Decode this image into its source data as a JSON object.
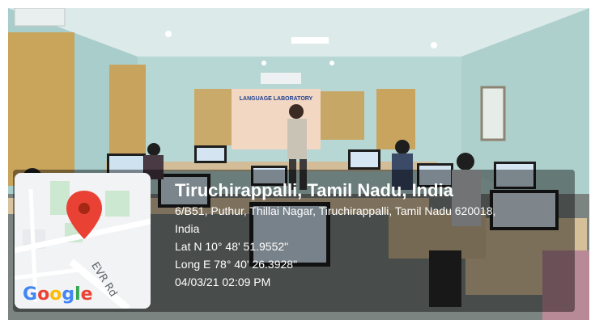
{
  "banner": {
    "title": "LANGUAGE LABORATORY"
  },
  "location": {
    "city": "Tiruchirappalli, Tamil Nadu, India",
    "address_line1": "6/B51, Puthur, Thillai Nagar, Tiruchirappalli, Tamil Nadu 620018,",
    "address_line2": "India",
    "latitude": "Lat N 10° 48' 51.9552\"",
    "longitude": "Long E 78° 40' 26.3928\"",
    "datetime": "04/03/21 02:09 PM"
  },
  "map": {
    "road_label": "EVR Rd",
    "pin_icon": "map-pin-icon",
    "logo_letters": [
      {
        "ch": "G",
        "color": "#4285F4"
      },
      {
        "ch": "o",
        "color": "#EA4335"
      },
      {
        "ch": "o",
        "color": "#FBBC05"
      },
      {
        "ch": "g",
        "color": "#4285F4"
      },
      {
        "ch": "l",
        "color": "#34A853"
      },
      {
        "ch": "e",
        "color": "#EA4335"
      }
    ]
  }
}
